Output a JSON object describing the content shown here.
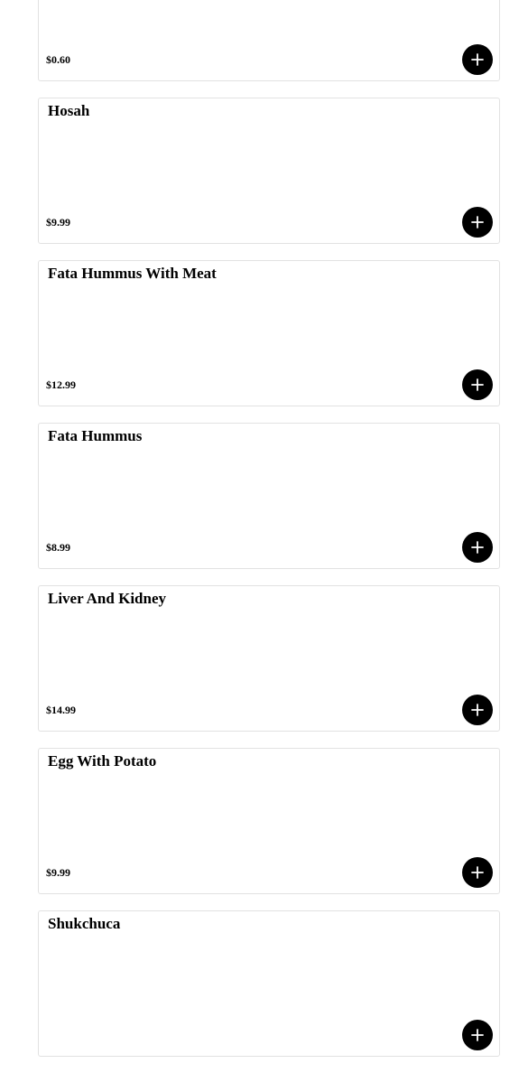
{
  "menu": {
    "items": [
      {
        "name": "",
        "price": "$0.60",
        "add_icon": "plus-icon"
      },
      {
        "name": "Hosah",
        "price": "$9.99",
        "add_icon": "plus-icon"
      },
      {
        "name": "Fata Hummus With Meat",
        "price": "$12.99",
        "add_icon": "plus-icon"
      },
      {
        "name": "Fata Hummus",
        "price": "$8.99",
        "add_icon": "plus-icon"
      },
      {
        "name": "Liver And Kidney",
        "price": "$14.99",
        "add_icon": "plus-icon"
      },
      {
        "name": "Egg With Potato",
        "price": "$9.99",
        "add_icon": "plus-icon"
      },
      {
        "name": "Shukchuca",
        "price": "",
        "add_icon": "plus-icon"
      }
    ]
  },
  "colors": {
    "button_bg": "#000000",
    "icon": "#ffffff",
    "card_border": "#e2e2e2",
    "text": "#000000"
  }
}
